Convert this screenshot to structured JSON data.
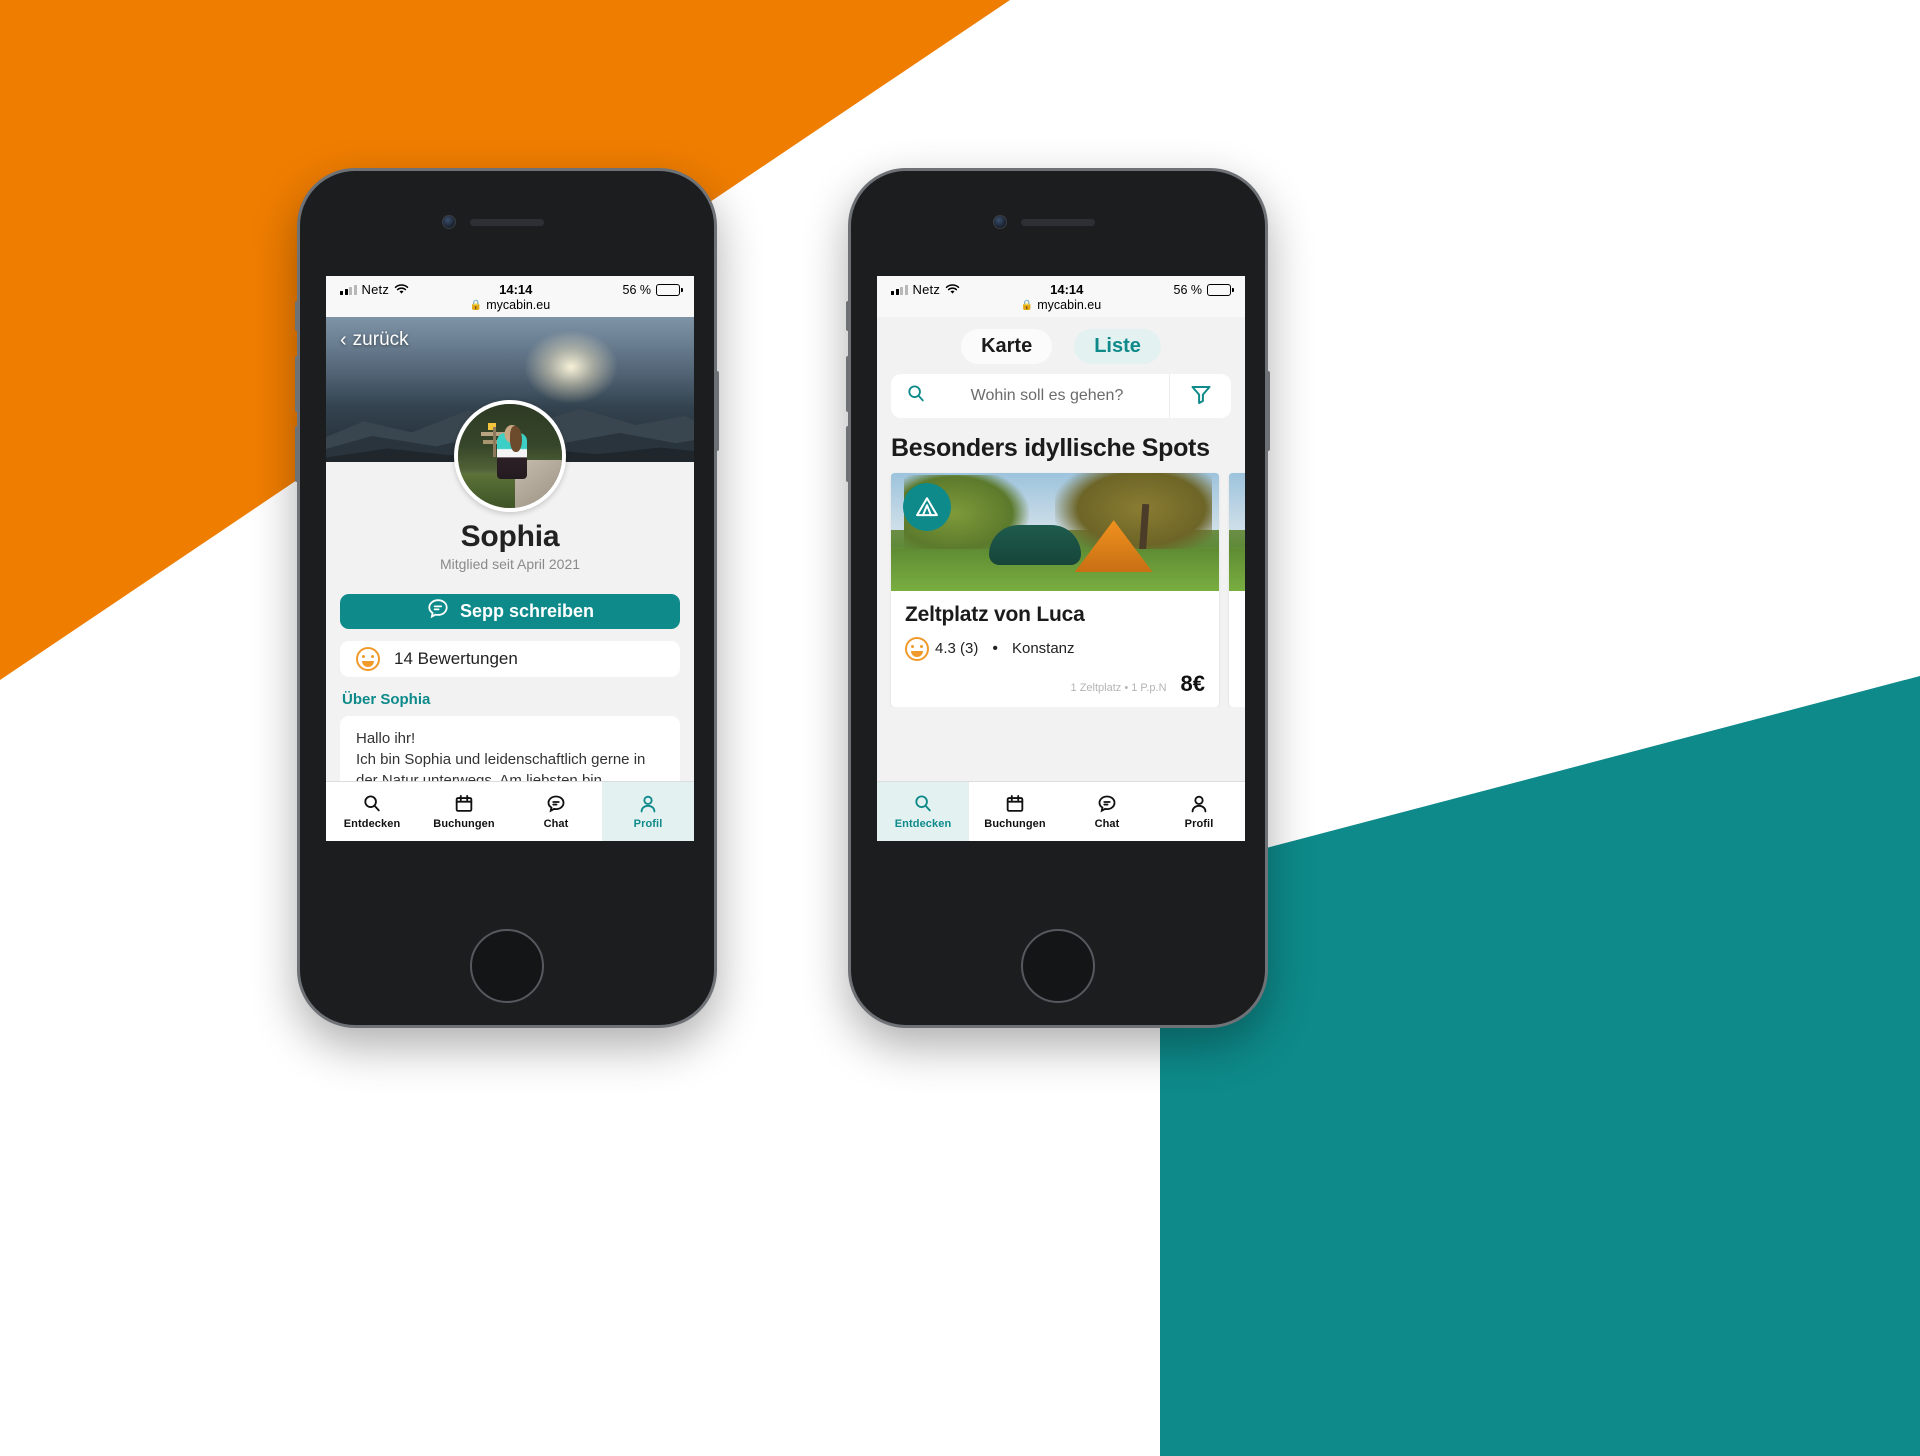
{
  "brand": {
    "teal": "#0e8a8a",
    "orange": "#ef7d00",
    "light_teal": "#e3f1f1"
  },
  "status_bar": {
    "carrier": "Netz",
    "time": "14:14",
    "battery_pct": "56 %",
    "url": "mycabin.eu",
    "lock_icon": "lock-icon",
    "wifi_icon": "wifi-icon",
    "signal_icon": "cellular-signal-icon"
  },
  "left_phone": {
    "back_label": "zurück",
    "back_icon": "chevron-left-icon",
    "profile": {
      "name": "Sophia",
      "member_since": "Mitglied seit April 2021"
    },
    "message_button": {
      "label": "Sepp schreiben",
      "icon": "chat-bubble-icon"
    },
    "reviews": {
      "label": "14 Bewertungen",
      "icon": "smiley-face-icon"
    },
    "about": {
      "heading": "Über Sophia",
      "text": "Hallo ihr!\nIch bin Sophia und leidenschaftlich gerne in der Natur unterwegs. Am liebsten bin"
    },
    "tabs": [
      {
        "label": "Entdecken",
        "icon": "search-icon",
        "active": false
      },
      {
        "label": "Buchungen",
        "icon": "calendar-icon",
        "active": false
      },
      {
        "label": "Chat",
        "icon": "chat-bubble-icon",
        "active": false
      },
      {
        "label": "Profil",
        "icon": "person-icon",
        "active": true
      }
    ]
  },
  "right_phone": {
    "segments": [
      {
        "label": "Karte",
        "active": true
      },
      {
        "label": "Liste",
        "active": false
      }
    ],
    "search": {
      "placeholder": "Wohin soll es gehen?",
      "value": "",
      "icon": "search-icon",
      "filter_icon": "filter-funnel-icon"
    },
    "section_title": "Besonders idyllische Spots",
    "cards": [
      {
        "badge_icon": "tent-icon",
        "title": "Zeltplatz von Luca",
        "rating": "4.3 (3)",
        "rating_icon": "smiley-face-icon",
        "separator": "•",
        "location": "Konstanz",
        "price_note": "1 Zeltplatz • 1 P.p.N",
        "price": "8€"
      }
    ],
    "tabs": [
      {
        "label": "Entdecken",
        "icon": "search-icon",
        "active": true
      },
      {
        "label": "Buchungen",
        "icon": "calendar-icon",
        "active": false
      },
      {
        "label": "Chat",
        "icon": "chat-bubble-icon",
        "active": false
      },
      {
        "label": "Profil",
        "icon": "person-icon",
        "active": false
      }
    ]
  }
}
